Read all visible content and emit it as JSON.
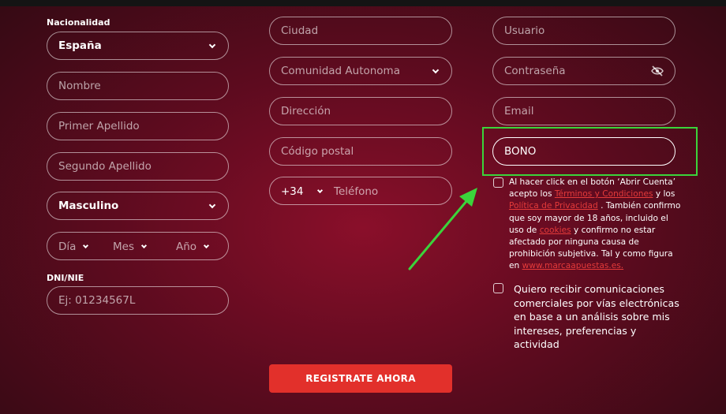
{
  "form": {
    "nationality_label": "Nacionalidad",
    "nationality_value": "España",
    "name_placeholder": "Nombre",
    "first_surname_placeholder": "Primer Apellido",
    "second_surname_placeholder": "Segundo Apellido",
    "gender_value": "Masculino",
    "dob": {
      "day": "Día",
      "month": "Mes",
      "year": "Año"
    },
    "dni_label": "DNI/NIE",
    "dni_placeholder": "Ej: 01234567L",
    "city_placeholder": "Ciudad",
    "region_placeholder": "Comunidad Autonoma",
    "address_placeholder": "Dirección",
    "postal_placeholder": "Código postal",
    "phone_prefix": "+34",
    "phone_placeholder": "Teléfono",
    "user_placeholder": "Usuario",
    "password_placeholder": "Contraseña",
    "email_placeholder": "Email",
    "bonus_value": "BONO"
  },
  "legal": {
    "part1": "Al hacer click en el botón ‘Abrir Cuenta’ acepto los ",
    "terms_link": "Términos y Condiciones",
    "part2": " y los ",
    "privacy_link": "Política de Privacidad",
    "part3": " . También confirmo que soy mayor de 18 años, incluido el uso de ",
    "cookies_link": "cookies",
    "part4": " y confirmo no estar afectado por ninguna causa de prohibición subjetiva. Tal y como figura en ",
    "site_link": "www.marcaapuestas.es."
  },
  "consent": {
    "text": "Quiero recibir comunicaciones comerciales por vías electrónicas en base a un análisis sobre mis intereses, preferencias y actividad"
  },
  "cta": {
    "label": "REGISTRATE AHORA"
  },
  "colors": {
    "accent": "#e2302b",
    "link": "#e53a3a",
    "highlight": "#3bd43b"
  }
}
